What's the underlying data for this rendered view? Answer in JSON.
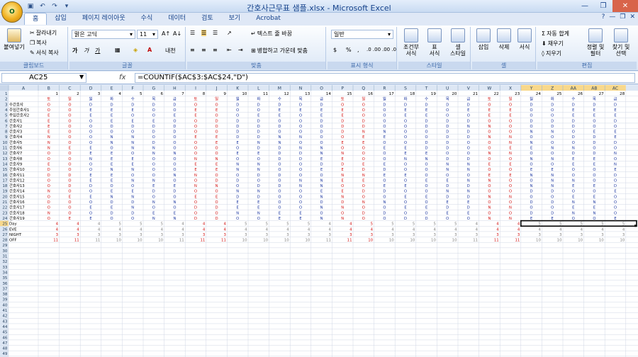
{
  "window": {
    "title": "간호사근무표 샘플.xlsx - Microsoft Excel"
  },
  "orb_label": "O",
  "tabs": [
    "홈",
    "삽입",
    "페이지 레이아웃",
    "수식",
    "데이터",
    "검토",
    "보기",
    "Acrobat"
  ],
  "active_tab": "홈",
  "ribbon": {
    "clipboard": {
      "paste": "붙여넣기",
      "cut": "잘라내기",
      "copy": "복사",
      "format_painter": "서식 복사",
      "label": "클립보드"
    },
    "font": {
      "name": "맑은 고딕",
      "size": "11",
      "bold": "가",
      "italic": "가",
      "underline": "가",
      "phonetic": "내천",
      "label": "글꼴"
    },
    "alignment": {
      "wrap": "텍스트 줄 바꿈",
      "merge": "병합하고 가운데 맞춤",
      "label": "맞춤"
    },
    "number": {
      "format": "일반",
      "currency": "$",
      "percent": "%",
      "comma": ",",
      "inc": ".0 .00",
      "dec": ".00 .0",
      "label": "표시 형식"
    },
    "styles": {
      "conditional": "조건부\n서식",
      "table": "표\n서식",
      "cell": "셀\n스타일",
      "label": "스타일"
    },
    "cells": {
      "insert": "삽입",
      "delete": "삭제",
      "format": "서식",
      "label": "셀"
    },
    "editing": {
      "autosum": "자동 합계",
      "fill": "채우기",
      "clear": "지우기",
      "sort": "정렬 및\n필터",
      "find": "찾기 및\n선택",
      "label": "편집"
    }
  },
  "formula_bar": {
    "name_box": "AC25",
    "fx": "fx",
    "formula": "=COUNTIF($AC$3:$AC$24,\"D\")"
  },
  "sheet": {
    "columns": [
      "A",
      "B",
      "C",
      "D",
      "E",
      "F",
      "G",
      "H",
      "I",
      "J",
      "K",
      "L",
      "M",
      "N",
      "O",
      "P",
      "Q",
      "R",
      "S",
      "T",
      "U",
      "V",
      "W",
      "X",
      "Y",
      "Z",
      "AA",
      "AB",
      "AC"
    ],
    "day_numbers": [
      "1",
      "2",
      "3",
      "4",
      "5",
      "6",
      "7",
      "8",
      "9",
      "10",
      "11",
      "12",
      "13",
      "14",
      "15",
      "16",
      "17",
      "18",
      "19",
      "20",
      "21",
      "22",
      "23",
      "24",
      "25",
      "26",
      "27",
      "28"
    ],
    "weekdays": [
      "토",
      "일",
      "월",
      "화",
      "수",
      "목",
      "금",
      "토",
      "일",
      "월",
      "화",
      "수",
      "목",
      "금",
      "토",
      "일",
      "월",
      "화",
      "수",
      "목",
      "금",
      "토",
      "일",
      "월",
      "화",
      "수",
      "목",
      "금"
    ],
    "nurses": [
      "수간호사",
      "주임간호사1",
      "주임간호사2",
      "간호사1",
      "간호사2",
      "간호사3",
      "간호사4",
      "간호사5",
      "간호사6",
      "간호사7",
      "간호사8",
      "간호사9",
      "간호사10",
      "간호사11",
      "간호사12",
      "간호사13",
      "간호사14",
      "간호사15",
      "간호사16",
      "간호사17",
      "간호사18",
      "간호사19"
    ],
    "schedule": [
      "OODDDDDOODDDDDOODDDDDOODDDDD",
      "OOEEEOOEEOOEEEEOOEEOEEEOOEEE",
      "EOEEOOEEOOEEOEEOOEEOOEEOOEEE",
      "EOOEEEOODDDOODDDOODDDOODDDOD",
      "EOODDDDOODDDOODDOODDNNOODDOO",
      "EOOOODDOODDOODDNNOODDOONNOEE",
      "NOONNOOEEDDNNOOEEOODDNNOODDE",
      "NOONNDOOEENNOOEEOODDOONNOODD",
      "NEEONNOOOODDNNOOEEDDOOEENNOO",
      "OOEEONNOOEEDDNNOOEEOONNOODDN",
      "OONEEOONNOODDEEOONNDDOONNEEO",
      "EOOEEOOEENNOODDEEOONNEEOOEEN",
      "DOONNOOEENNOOEEDDOONNOOEEOOE",
      "DDEEOONNOODDOONNEEOOOEENNOOD",
      "OOEENNOODDOONNEEOOEENNOONNOO",
      "ODDOOEENNODDNNOOEEODDOONNEED",
      "NOOEEDDOONNOOEEDDOONNOODDOOE",
      "OEENNOOEEDDOONNOOEEDDNNOOEEO",
      "DOODDNNOOEEOODDNNOOEEOODDNNO",
      "OOEENOODDEEOONNOOEEDDNNOOEEO",
      "NOODDEEOONNEEOODDOOEEOODDNNO",
      "OEEOONNDDOOEENNOODDOONNEEOOE"
    ],
    "summary": [
      {
        "label": "Day",
        "values": [
          4,
          4,
          4,
          5,
          5,
          5,
          4,
          4,
          4,
          5,
          5,
          5,
          5,
          4,
          4,
          5,
          5,
          5,
          5,
          5,
          4,
          4,
          4,
          5,
          5,
          5,
          5,
          5
        ]
      },
      {
        "label": "EVE",
        "values": [
          4,
          4,
          4,
          4,
          4,
          4,
          4,
          4,
          4,
          4,
          4,
          4,
          4,
          4,
          4,
          4,
          4,
          4,
          4,
          4,
          4,
          4,
          4,
          4,
          4,
          4,
          4,
          4
        ]
      },
      {
        "label": "NIGHT",
        "values": [
          3,
          3,
          3,
          3,
          3,
          3,
          3,
          3,
          3,
          3,
          3,
          3,
          3,
          3,
          3,
          3,
          3,
          3,
          3,
          3,
          3,
          3,
          3,
          3,
          3,
          3,
          3,
          3
        ]
      },
      {
        "label": "OFF",
        "values": [
          11,
          11,
          11,
          10,
          10,
          10,
          11,
          11,
          11,
          10,
          10,
          10,
          10,
          11,
          11,
          10,
          10,
          10,
          10,
          10,
          11,
          11,
          11,
          10,
          10,
          10,
          10,
          10
        ]
      }
    ],
    "row_count": 50,
    "selected_cell": "AC25",
    "selected_range_row": 25,
    "colors": {
      "header_bg": "#dde7f4",
      "selected_header": "#f8d88c",
      "grid_line": "#d0d7e5",
      "weekend_red": "#d01010",
      "weekday_blue": "#1a35a0",
      "text_gray": "#7f7f7f",
      "selection": "#000000"
    }
  }
}
